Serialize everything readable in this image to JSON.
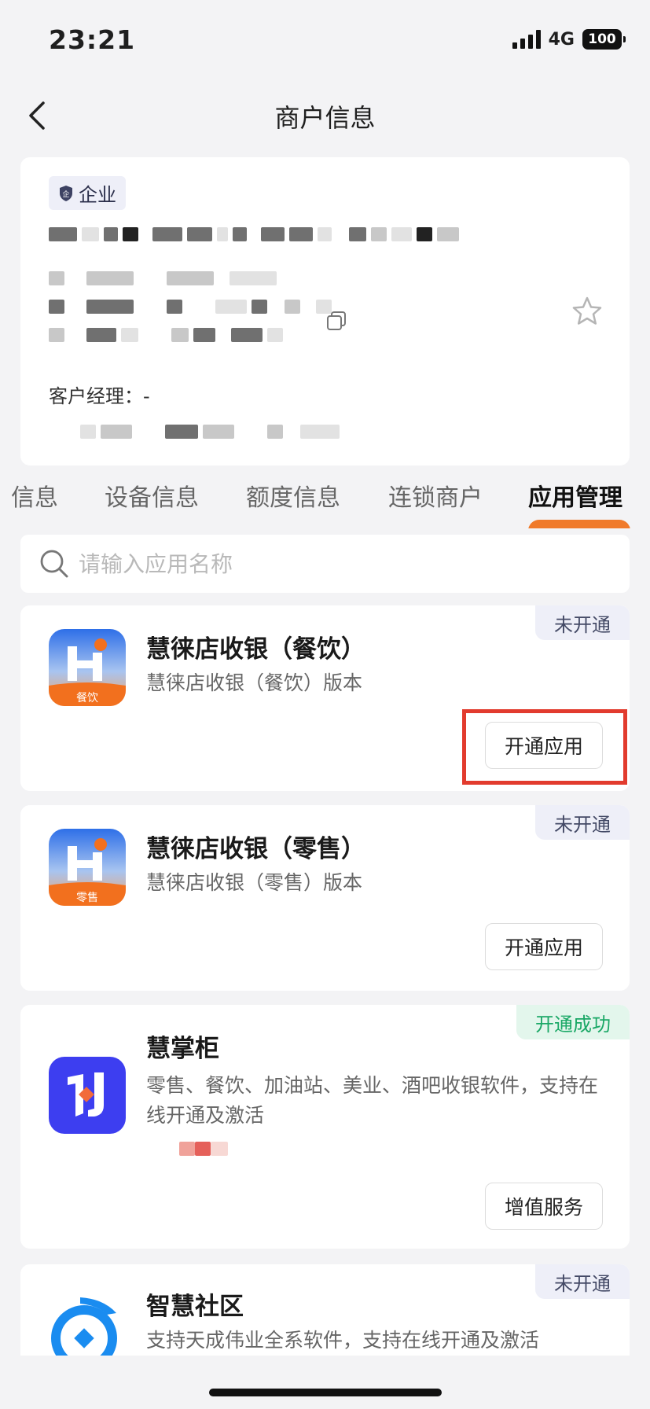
{
  "status": {
    "time": "23:21",
    "network": "4G",
    "battery": "100"
  },
  "nav": {
    "title": "商户信息"
  },
  "merchant": {
    "tag": "企业",
    "manager_label": "客户经理：-"
  },
  "tabs": [
    {
      "label": "信息"
    },
    {
      "label": "设备信息"
    },
    {
      "label": "额度信息"
    },
    {
      "label": "连锁商户"
    },
    {
      "label": "应用管理",
      "active": true
    }
  ],
  "search": {
    "placeholder": "请输入应用名称",
    "value": ""
  },
  "apps": [
    {
      "name": "慧徕店收银（餐饮）",
      "desc": "慧徕店收银（餐饮）版本",
      "status": "未开通",
      "button": "开通应用",
      "icon_label": "餐饮"
    },
    {
      "name": "慧徕店收银（零售）",
      "desc": "慧徕店收银（零售）版本",
      "status": "未开通",
      "button": "开通应用",
      "icon_label": "零售"
    },
    {
      "name": "慧掌柜",
      "desc": "零售、餐饮、加油站、美业、酒吧收银软件，支持在线开通及激活",
      "status": "开通成功",
      "button": "增值服务"
    },
    {
      "name": "智慧社区",
      "desc": "支持天成伟业全系软件，支持在线开通及激活",
      "status": "未开通"
    }
  ],
  "colors": {
    "accent": "#f07a2a",
    "highlight": "#e23b2e",
    "success": "#1aa866"
  }
}
